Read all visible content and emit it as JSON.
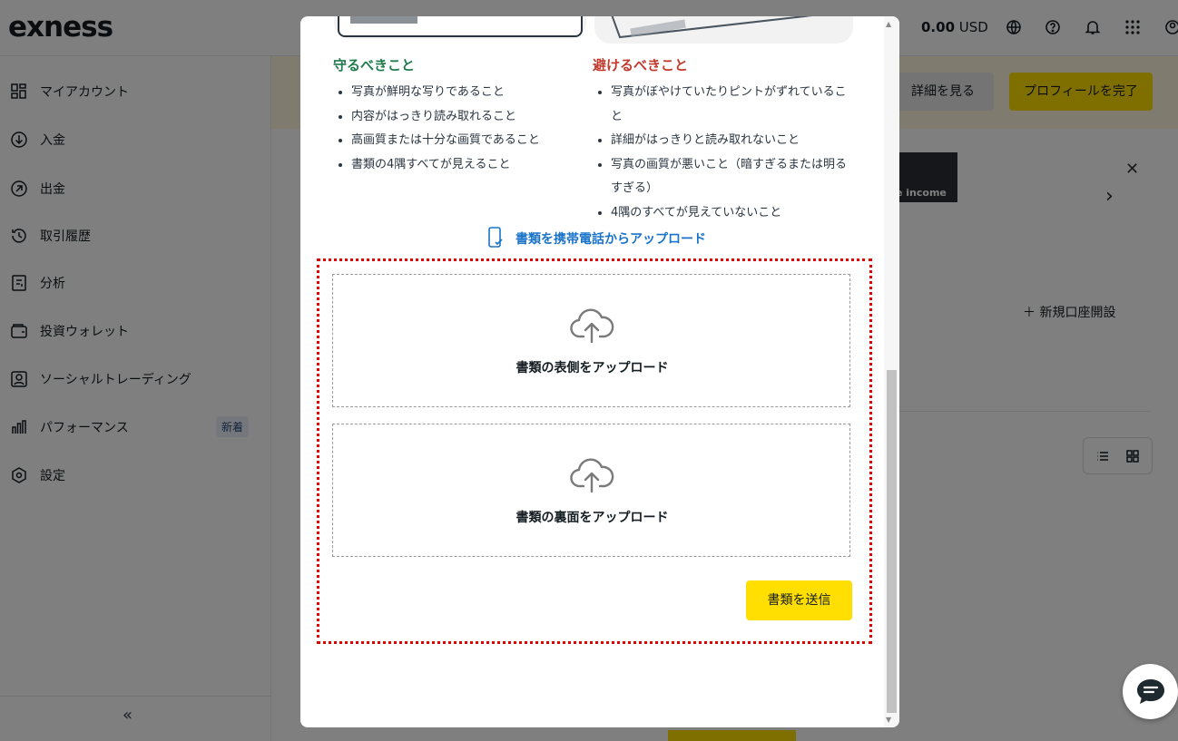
{
  "app": {
    "logo": "exness",
    "balance_amount": "0.00",
    "balance_currency": "USD"
  },
  "sidebar": {
    "items": [
      {
        "label": "マイアカウント",
        "icon": "grid-icon"
      },
      {
        "label": "入金",
        "icon": "arrow-down-circle-icon"
      },
      {
        "label": "出金",
        "icon": "arrow-up-right-circle-icon"
      },
      {
        "label": "取引履歴",
        "icon": "history-icon"
      },
      {
        "label": "分析",
        "icon": "analytics-icon"
      },
      {
        "label": "投資ウォレット",
        "icon": "wallet-icon"
      },
      {
        "label": "ソーシャルトレーディング",
        "icon": "social-trading-icon"
      },
      {
        "label": "パフォーマンス",
        "icon": "bar-chart-icon",
        "badge": "新着"
      },
      {
        "label": "設定",
        "icon": "settings-icon"
      }
    ],
    "collapse": "«"
  },
  "header_banner": {
    "detail_button": "詳細を見る",
    "complete_button": "プロフィールを完了"
  },
  "promo": {
    "image_text": "e income"
  },
  "main": {
    "new_account": "新規口座開設"
  },
  "modal": {
    "do_title": "守るべきこと",
    "do_items": [
      "写真が鮮明な写りであること",
      "内容がはっきり読み取れること",
      "高画質または十分な画質であること",
      "書類の4隅すべてが見えること"
    ],
    "avoid_title": "避けるべきこと",
    "avoid_items": [
      "写真がぼやけていたりピントがずれていること",
      "詳細がはっきりと読み取れないこと",
      "写真の画質が悪いこと（暗すぎるまたは明るすぎる）",
      "4隅のすべてが見えていないこと"
    ],
    "mobile_upload_link": "書類を携帯電話からアップロード",
    "upload_front": "書類の表側をアップロード",
    "upload_back": "書類の裏面をアップロード",
    "submit_button": "書類を送信"
  },
  "colors": {
    "accent_yellow": "#ffde02",
    "good_green": "#1f7a4d",
    "bad_red": "#c0392b",
    "link_blue": "#1a73c8",
    "highlight_red": "#e00000"
  }
}
